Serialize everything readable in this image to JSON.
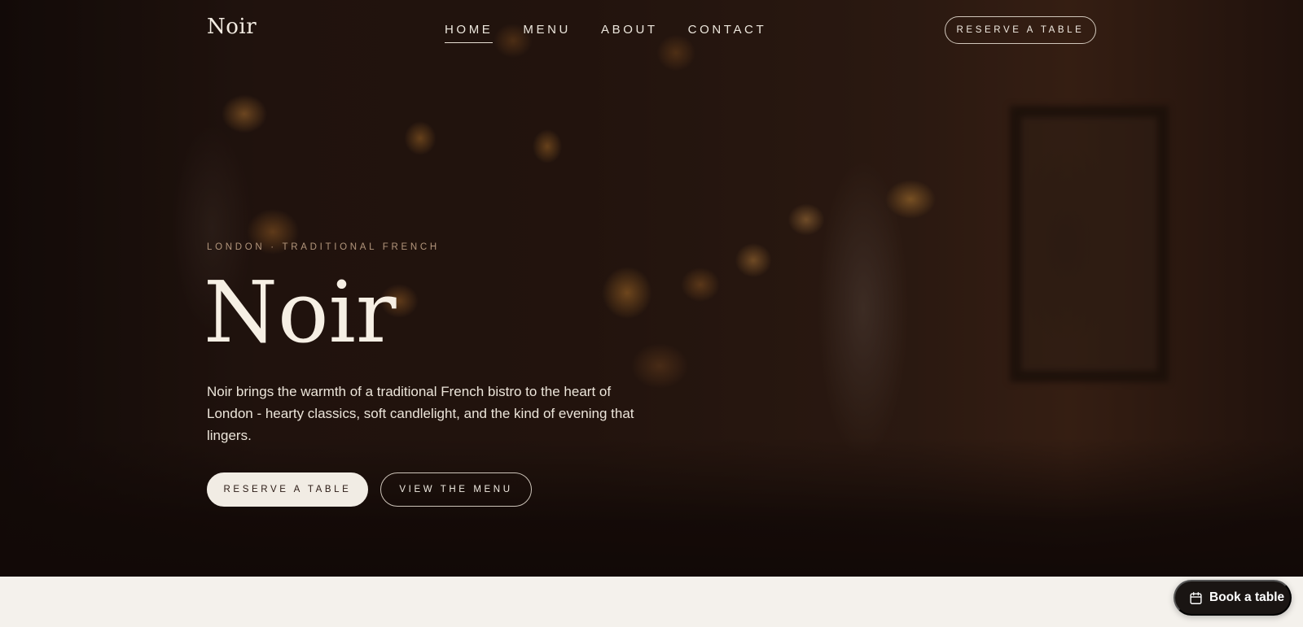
{
  "brand": {
    "logo": "Noir"
  },
  "nav": {
    "links": [
      {
        "label": "HOME",
        "active": true
      },
      {
        "label": "MENU",
        "active": false
      },
      {
        "label": "ABOUT",
        "active": false
      },
      {
        "label": "CONTACT",
        "active": false
      }
    ],
    "cta_label": "RESERVE A TABLE"
  },
  "hero": {
    "eyebrow": "LONDON · TRADITIONAL FRENCH",
    "title": "Noir",
    "description": "Noir brings the warmth of a traditional French bistro to the heart of London - hearty classics, soft candlelight, and the kind of evening that lingers.",
    "primary_button": "RESERVE A TABLE",
    "secondary_button": "VIEW THE MENU"
  },
  "floating": {
    "book_label": "Book a table",
    "icon": "calendar-icon"
  },
  "colors": {
    "hero_bg": "#1c0f0b",
    "text_light": "#f6efe4",
    "eyebrow": "#b3967c",
    "page_bg": "#f4f1ec",
    "floating_bg": "#1a1513"
  }
}
